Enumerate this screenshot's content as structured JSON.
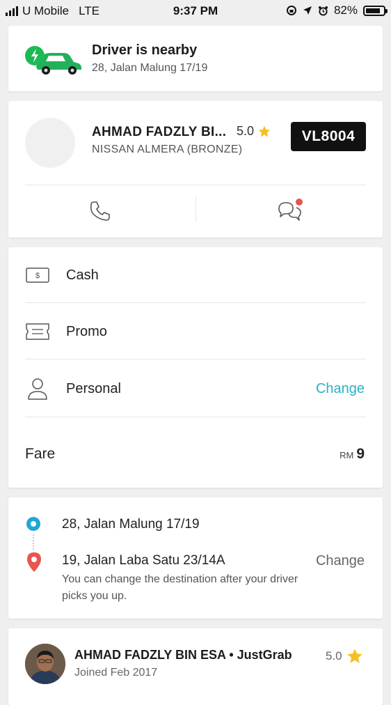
{
  "status_bar": {
    "carrier": "U Mobile",
    "network": "LTE",
    "time": "9:37 PM",
    "battery": "82%",
    "battery_level": 0.82
  },
  "nearby_card": {
    "title": "Driver is nearby",
    "address": "28, Jalan Malung 17/19",
    "accent_color": "#1db954"
  },
  "driver_card": {
    "name": "AHMAD FADZLY BI...",
    "rating": "5.0",
    "car": "NISSAN ALMERA (BRONZE)",
    "plate": "VL8004",
    "icons": {
      "call": "phone-icon",
      "chat": "chat-icon"
    },
    "chat_badge_color": "#e8554e"
  },
  "payment_card": {
    "rows": [
      {
        "label": "Cash",
        "icon": "cash-icon"
      },
      {
        "label": "Promo",
        "icon": "ticket-icon"
      },
      {
        "label": "Personal",
        "icon": "person-icon",
        "action": "Change"
      }
    ],
    "fare_label": "Fare",
    "fare_currency": "RM",
    "fare_amount": "9",
    "link_color": "#2bb0c6"
  },
  "route_card": {
    "pickup": "28, Jalan Malung 17/19",
    "dropoff": "19, Jalan Laba Satu 23/14A",
    "note": "You can change the destination after your driver picks you up.",
    "change_label": "Change",
    "pickup_color": "#1ea8d6",
    "dropoff_color": "#e8554e"
  },
  "driver_profile": {
    "full_name": "AHMAD FADZLY BIN ESA • JustGrab",
    "rating": "5.0",
    "joined": "Joined Feb 2017"
  }
}
